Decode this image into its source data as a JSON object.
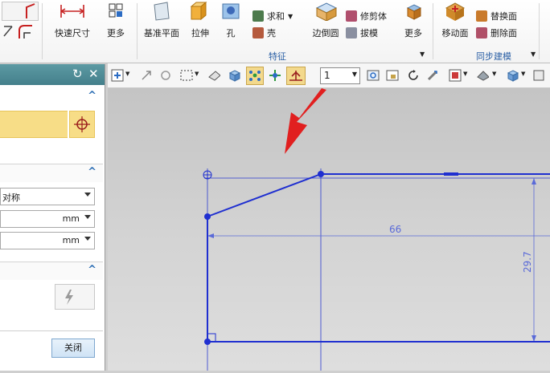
{
  "ribbon": {
    "quick_dim": "快速尺寸",
    "more1": "更多",
    "datum_plane": "基准平面",
    "extrude": "拉伸",
    "hole": "孔",
    "unite": "求和",
    "shell": "壳",
    "edge_blend": "边倒圆",
    "trim_body": "修剪体",
    "draft": "拔模",
    "more2": "更多",
    "move_face": "移动面",
    "replace_face": "替换面",
    "delete_face": "删除面",
    "group_feature": "特征",
    "group_sync": "同步建模"
  },
  "toolbar": {
    "scale_value": "1"
  },
  "panel": {
    "symmetric": "对称",
    "unit1": "mm",
    "unit2": "mm",
    "close": "关闭"
  },
  "sketch": {
    "dim_horizontal": "66",
    "dim_vertical": "29.7"
  },
  "colors": {
    "sketch": "#1f2fd0",
    "arrow": "#e11f1f",
    "highlight": "#f7dd87"
  }
}
